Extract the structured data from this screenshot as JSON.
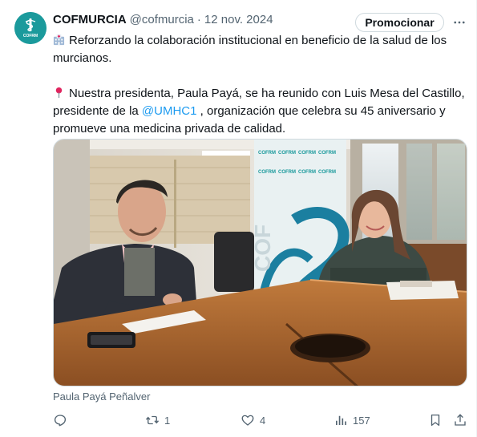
{
  "author": {
    "display_name": "COFMURCIA",
    "handle": "@cofmurcia",
    "separator": "·",
    "date": "12 nov. 2024",
    "avatar_text": "COFRM"
  },
  "promote_label": "Promocionar",
  "text": {
    "p1": "Reforzando la colaboración institucional en beneficio de la salud de los murcianos.",
    "p2_before": "Nuestra presidenta, Paula Payá, se ha reunido con Luis Mesa del Castillo, presidente de la ",
    "mention": "@UMHC1",
    "p2_after": " , organización que celebra su 45 aniversario y promueve una medicina privada de calidad."
  },
  "photo_credit": "Paula Payá Peñalver",
  "metrics": {
    "replies": "",
    "retweets": "1",
    "likes": "4",
    "views": "157"
  },
  "icons": {
    "reply": "reply-icon",
    "retweet": "retweet-icon",
    "like": "heart-icon",
    "views": "views-icon",
    "bookmark": "bookmark-icon",
    "share": "share-icon",
    "more": "more-icon",
    "hospital_emoji": "hospital-icon",
    "pin_emoji": "pin-icon"
  },
  "colors": {
    "brand": "#1b9a9c",
    "link": "#1d9bf0",
    "secondary_text": "#536471"
  }
}
